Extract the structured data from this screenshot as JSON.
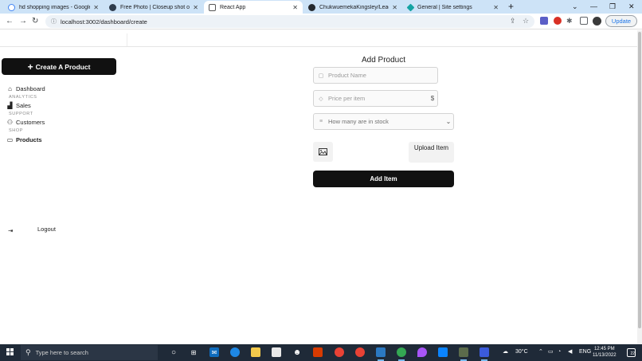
{
  "browser": {
    "tabs": [
      {
        "label": "hd shopping images - Google Se",
        "favicon": "google-icon",
        "active": false
      },
      {
        "label": "Free Photo | Closeup shot of two",
        "favicon": "freepik-icon",
        "active": false
      },
      {
        "label": "React App",
        "favicon": "react-icon",
        "active": true
      },
      {
        "label": "ChukwuemekaKingsley/Leading",
        "favicon": "github-icon",
        "active": false
      },
      {
        "label": "General | Site settings",
        "favicon": "netlify-icon",
        "active": false
      }
    ],
    "tab_close": "✕",
    "new_tab": "+",
    "window_controls": {
      "dropdown": "⌄",
      "minimize": "—",
      "restore": "❐",
      "close": "✕"
    },
    "address": {
      "url": "localhost:3002/dashboard/create"
    },
    "update_label": "Update"
  },
  "app": {
    "create_button": {
      "icon": "plus-icon",
      "label": "Create A Product"
    },
    "sidebar": {
      "dashboard": {
        "icon": "home-icon",
        "label": "Dashboard"
      },
      "section_analytics": "ANALYTICS",
      "sales": {
        "icon": "bar-chart-icon",
        "label": "Sales"
      },
      "section_support": "SUPPORT",
      "customers": {
        "icon": "users-icon",
        "label": "Customers"
      },
      "section_shop": "SHOP",
      "products": {
        "icon": "folder-icon",
        "label": "Products"
      }
    },
    "logout": {
      "icon": "logout-icon",
      "label": "Logout"
    },
    "form": {
      "title": "Add Product",
      "product_name": {
        "placeholder": "Product Name",
        "icon": "bag-icon"
      },
      "price": {
        "placeholder": "Price per item",
        "icon": "tag-icon",
        "suffix": "$"
      },
      "stock": {
        "selected": "How many are in stock",
        "icon": "list-icon"
      },
      "image_icon": "image-icon",
      "upload_label": "Upload Item",
      "submit_label": "Add Item"
    }
  },
  "taskbar": {
    "search_placeholder": "Type here to search",
    "weather": "30°C",
    "language": "ENG",
    "time": "12:45 PM",
    "date": "11/13/2022",
    "notification_count": "22"
  }
}
